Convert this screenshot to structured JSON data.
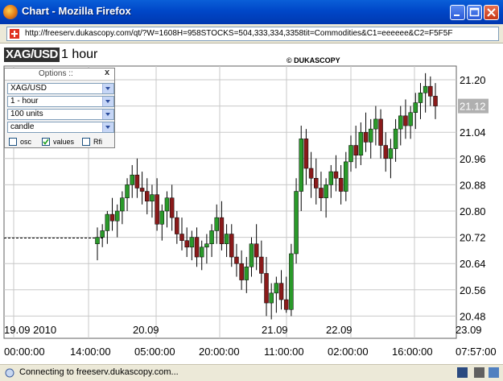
{
  "window": {
    "title": "Chart - Mozilla Firefox"
  },
  "address_bar": {
    "url": "http://freeserv.dukascopy.com/qt/?W=1608H=958STOCKS=504,333,334,3358tit=Commodities&C1=eeeeee&C2=F5F5F"
  },
  "chart_header": {
    "symbol": "XAG/USD",
    "interval": "1 hour",
    "copyright": "© DUKASCOPY"
  },
  "options_panel": {
    "title": "Options ::",
    "close": "x",
    "instrument": "XAG/USD",
    "period": "1 - hour",
    "units": "100 units",
    "style": "candle",
    "checkboxes": [
      {
        "label": "osc",
        "checked": false
      },
      {
        "label": "values",
        "checked": true
      },
      {
        "label": "Rfi",
        "checked": false
      }
    ]
  },
  "status_bar": {
    "text": "Connecting to freeserv.dukascopy.com..."
  },
  "colors": {
    "up_candle": "#2a9a2a",
    "down_candle": "#8a1a1a",
    "wick": "#000000",
    "grid": "#c8c8c8",
    "price_tag_bg": "#b0b0b0"
  },
  "chart_data": {
    "type": "candlestick",
    "y_ticks": [
      "21.20",
      "21.12",
      "21.04",
      "20.96",
      "20.88",
      "20.80",
      "20.72",
      "20.64",
      "20.56",
      "20.48"
    ],
    "ylim": [
      20.47,
      21.25
    ],
    "current_price": "21.12",
    "date_labels": [
      "19.09 2010",
      "20.09",
      "21.09",
      "22.09",
      "23.09"
    ],
    "time_labels": [
      "00:00:00",
      "14:00:00",
      "05:00:00",
      "20:00:00",
      "11:00:00",
      "02:00:00",
      "16:00:00",
      "07:57:00"
    ],
    "reference_line": 20.72,
    "candles": [
      {
        "o": 20.7,
        "h": 20.75,
        "l": 20.65,
        "c": 20.72
      },
      {
        "o": 20.72,
        "h": 20.76,
        "l": 20.69,
        "c": 20.74
      },
      {
        "o": 20.74,
        "h": 20.8,
        "l": 20.7,
        "c": 20.79
      },
      {
        "o": 20.79,
        "h": 20.84,
        "l": 20.74,
        "c": 20.77
      },
      {
        "o": 20.77,
        "h": 20.82,
        "l": 20.72,
        "c": 20.8
      },
      {
        "o": 20.8,
        "h": 20.86,
        "l": 20.76,
        "c": 20.84
      },
      {
        "o": 20.84,
        "h": 20.9,
        "l": 20.8,
        "c": 20.88
      },
      {
        "o": 20.88,
        "h": 20.94,
        "l": 20.84,
        "c": 20.91
      },
      {
        "o": 20.91,
        "h": 20.96,
        "l": 20.84,
        "c": 20.87
      },
      {
        "o": 20.87,
        "h": 20.92,
        "l": 20.82,
        "c": 20.86
      },
      {
        "o": 20.86,
        "h": 20.9,
        "l": 20.79,
        "c": 20.83
      },
      {
        "o": 20.83,
        "h": 20.88,
        "l": 20.78,
        "c": 20.85
      },
      {
        "o": 20.85,
        "h": 20.9,
        "l": 20.74,
        "c": 20.76
      },
      {
        "o": 20.76,
        "h": 20.82,
        "l": 20.71,
        "c": 20.8
      },
      {
        "o": 20.8,
        "h": 20.86,
        "l": 20.75,
        "c": 20.84
      },
      {
        "o": 20.84,
        "h": 20.88,
        "l": 20.74,
        "c": 20.78
      },
      {
        "o": 20.78,
        "h": 20.8,
        "l": 20.7,
        "c": 20.73
      },
      {
        "o": 20.73,
        "h": 20.78,
        "l": 20.68,
        "c": 20.71
      },
      {
        "o": 20.71,
        "h": 20.75,
        "l": 20.66,
        "c": 20.69
      },
      {
        "o": 20.69,
        "h": 20.74,
        "l": 20.65,
        "c": 20.72
      },
      {
        "o": 20.72,
        "h": 20.75,
        "l": 20.63,
        "c": 20.66
      },
      {
        "o": 20.66,
        "h": 20.71,
        "l": 20.62,
        "c": 20.69
      },
      {
        "o": 20.69,
        "h": 20.73,
        "l": 20.64,
        "c": 20.7
      },
      {
        "o": 20.7,
        "h": 20.76,
        "l": 20.66,
        "c": 20.74
      },
      {
        "o": 20.74,
        "h": 20.82,
        "l": 20.7,
        "c": 20.78
      },
      {
        "o": 20.78,
        "h": 20.83,
        "l": 20.68,
        "c": 20.7
      },
      {
        "o": 20.7,
        "h": 20.76,
        "l": 20.66,
        "c": 20.73
      },
      {
        "o": 20.73,
        "h": 20.76,
        "l": 20.63,
        "c": 20.66
      },
      {
        "o": 20.66,
        "h": 20.7,
        "l": 20.6,
        "c": 20.64
      },
      {
        "o": 20.64,
        "h": 20.68,
        "l": 20.56,
        "c": 20.59
      },
      {
        "o": 20.59,
        "h": 20.66,
        "l": 20.55,
        "c": 20.63
      },
      {
        "o": 20.63,
        "h": 20.72,
        "l": 20.6,
        "c": 20.7
      },
      {
        "o": 20.7,
        "h": 20.76,
        "l": 20.62,
        "c": 20.66
      },
      {
        "o": 20.66,
        "h": 20.71,
        "l": 20.58,
        "c": 20.61
      },
      {
        "o": 20.61,
        "h": 20.66,
        "l": 20.48,
        "c": 20.52
      },
      {
        "o": 20.52,
        "h": 20.58,
        "l": 20.47,
        "c": 20.55
      },
      {
        "o": 20.55,
        "h": 20.6,
        "l": 20.49,
        "c": 20.58
      },
      {
        "o": 20.58,
        "h": 20.62,
        "l": 20.5,
        "c": 20.53
      },
      {
        "o": 20.53,
        "h": 20.6,
        "l": 20.49,
        "c": 20.5
      },
      {
        "o": 20.5,
        "h": 20.7,
        "l": 20.48,
        "c": 20.67
      },
      {
        "o": 20.67,
        "h": 20.9,
        "l": 20.64,
        "c": 20.86
      },
      {
        "o": 20.86,
        "h": 21.06,
        "l": 20.8,
        "c": 21.02
      },
      {
        "o": 21.02,
        "h": 21.05,
        "l": 20.88,
        "c": 20.93
      },
      {
        "o": 20.93,
        "h": 20.98,
        "l": 20.84,
        "c": 20.9
      },
      {
        "o": 20.9,
        "h": 20.96,
        "l": 20.82,
        "c": 20.87
      },
      {
        "o": 20.87,
        "h": 20.92,
        "l": 20.8,
        "c": 20.84
      },
      {
        "o": 20.84,
        "h": 20.9,
        "l": 20.78,
        "c": 20.88
      },
      {
        "o": 20.88,
        "h": 20.94,
        "l": 20.84,
        "c": 20.92
      },
      {
        "o": 20.92,
        "h": 20.97,
        "l": 20.86,
        "c": 20.9
      },
      {
        "o": 20.9,
        "h": 20.94,
        "l": 20.82,
        "c": 20.86
      },
      {
        "o": 20.86,
        "h": 20.98,
        "l": 20.83,
        "c": 20.95
      },
      {
        "o": 20.95,
        "h": 21.03,
        "l": 20.92,
        "c": 21.0
      },
      {
        "o": 21.0,
        "h": 21.06,
        "l": 20.93,
        "c": 20.97
      },
      {
        "o": 20.97,
        "h": 21.07,
        "l": 20.94,
        "c": 21.04
      },
      {
        "o": 21.04,
        "h": 21.1,
        "l": 20.98,
        "c": 21.01
      },
      {
        "o": 21.01,
        "h": 21.08,
        "l": 20.96,
        "c": 21.05
      },
      {
        "o": 21.05,
        "h": 21.12,
        "l": 21.0,
        "c": 21.08
      },
      {
        "o": 21.08,
        "h": 21.11,
        "l": 20.96,
        "c": 21.0
      },
      {
        "o": 21.0,
        "h": 21.04,
        "l": 20.92,
        "c": 20.96
      },
      {
        "o": 20.96,
        "h": 21.02,
        "l": 20.9,
        "c": 20.99
      },
      {
        "o": 20.99,
        "h": 21.08,
        "l": 20.95,
        "c": 21.05
      },
      {
        "o": 21.05,
        "h": 21.12,
        "l": 21.0,
        "c": 21.09
      },
      {
        "o": 21.09,
        "h": 21.14,
        "l": 21.02,
        "c": 21.06
      },
      {
        "o": 21.06,
        "h": 21.12,
        "l": 21.02,
        "c": 21.1
      },
      {
        "o": 21.1,
        "h": 21.16,
        "l": 21.05,
        "c": 21.13
      },
      {
        "o": 21.13,
        "h": 21.19,
        "l": 21.08,
        "c": 21.16
      },
      {
        "o": 21.16,
        "h": 21.22,
        "l": 21.1,
        "c": 21.18
      },
      {
        "o": 21.18,
        "h": 21.21,
        "l": 21.12,
        "c": 21.15
      },
      {
        "o": 21.15,
        "h": 21.19,
        "l": 21.08,
        "c": 21.12
      }
    ]
  }
}
